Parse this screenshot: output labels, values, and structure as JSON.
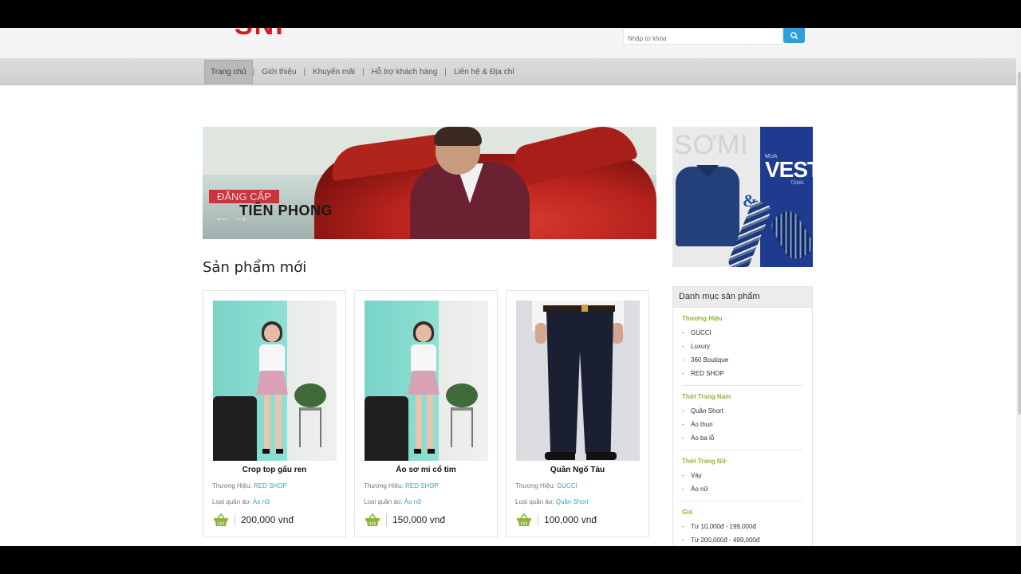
{
  "header": {
    "logo_text": "SNI",
    "search": {
      "placeholder": "Nhập từ khóa"
    }
  },
  "nav": {
    "items": [
      {
        "label": "Trang chủ",
        "active": true
      },
      {
        "label": "Giới thiệu"
      },
      {
        "label": "Khuyến mãi"
      },
      {
        "label": "Hỗ trợ khách hàng"
      },
      {
        "label": "Liên hệ & Địa chỉ"
      }
    ],
    "separator": "|"
  },
  "banner": {
    "tag": "ĐẲNG CẤP",
    "title": "TIÊN PHONG"
  },
  "promo": {
    "somi": "SƠMI",
    "amp": "&",
    "mua": "MUA",
    "vest": "VEST",
    "tang": "TẶNG"
  },
  "section": {
    "title": "Sản phẩm mới"
  },
  "products": [
    {
      "name": "Crop top gấu ren",
      "brand_label": "Thương Hiệu:",
      "brand": "RED SHOP",
      "type_label": "Loại quần áo:",
      "type": "Áo nữ",
      "price": "200,000 vnđ"
    },
    {
      "name": "Áo sơ mi cổ tim",
      "brand_label": "Thương Hiệu:",
      "brand": "RED SHOP",
      "type_label": "Loại quần áo:",
      "type": "Áo nữ",
      "price": "150,000 vnđ"
    },
    {
      "name": "Quần Ngố Tàu",
      "brand_label": "Thương Hiệu:",
      "brand": "GUCCI",
      "type_label": "Loại quần áo:",
      "type": "Quần Short",
      "price": "100,000 vnđ"
    }
  ],
  "sidebar": {
    "title": "Danh mục sản phẩm",
    "groups": [
      {
        "title": "Thương Hiệu",
        "items": [
          "GUCCI",
          "Luxury",
          "360 Boutique",
          "RED SHOP"
        ]
      },
      {
        "title": "Thời Trang Nam",
        "items": [
          "Quần Short",
          "Áo thun",
          "Áo ba lỗ"
        ]
      },
      {
        "title": "Thời Trang Nữ",
        "items": [
          "Váy",
          "Áo nữ"
        ]
      },
      {
        "title": "Giá",
        "items": [
          "Từ 10,000đ - 199,000đ",
          "Từ 200,000đ - 499,000đ"
        ]
      }
    ],
    "dash": "-"
  },
  "colors": {
    "accent": "#2e9fd6",
    "link": "#36a3d9",
    "category": "#8cb539",
    "basket": "#8cb539",
    "brand_red": "#d6191f"
  },
  "icons": {
    "search": "search-icon",
    "basket": "basket-icon",
    "arrow_left": "arrow-left-icon",
    "arrow_right": "arrow-right-icon"
  }
}
